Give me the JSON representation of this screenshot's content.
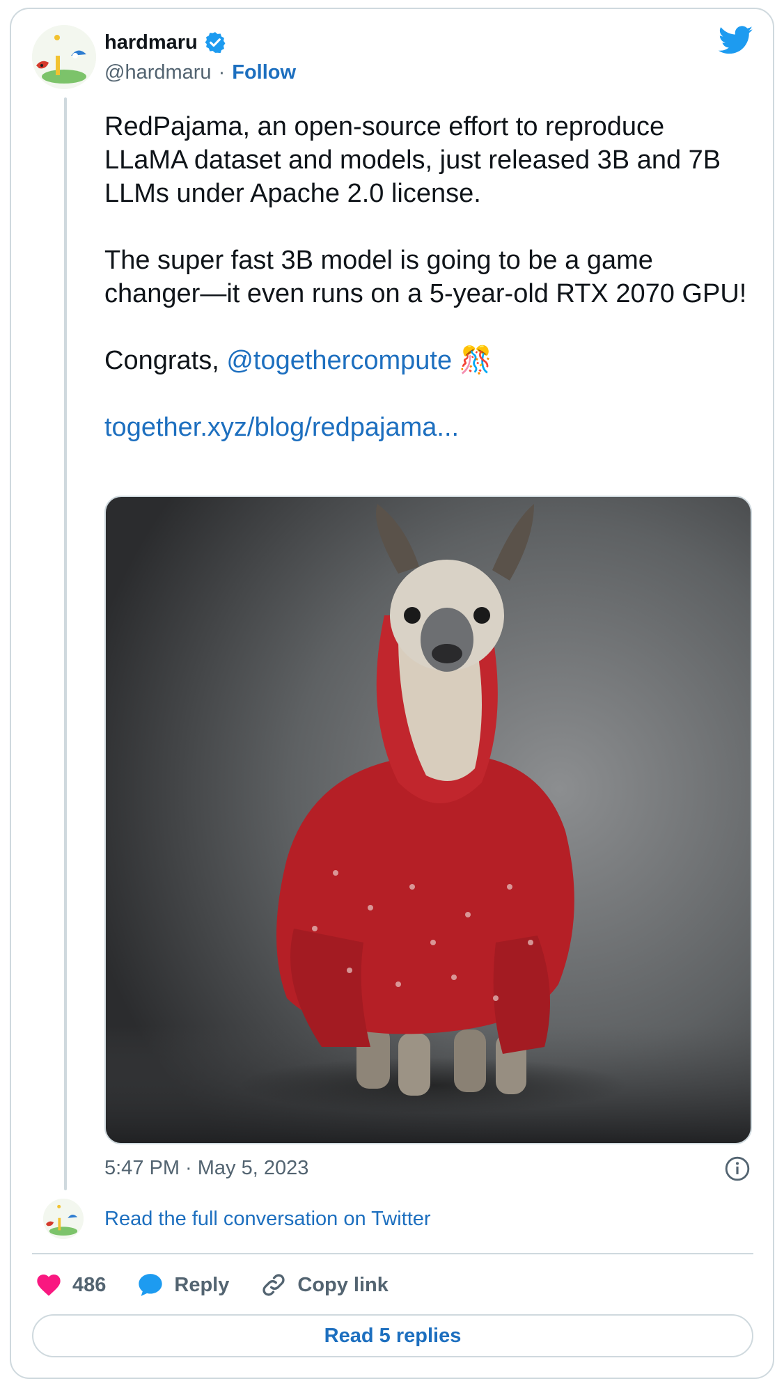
{
  "author": {
    "name": "hardmaru",
    "handle": "@hardmaru",
    "separator": "·",
    "follow_label": "Follow"
  },
  "tweet": {
    "paragraph_1": "RedPajama, an open-source effort to reproduce LLaMA dataset and models, just released 3B and 7B LLMs under Apache 2.0 license.",
    "paragraph_2": "The super fast 3B model is going to be a game changer—it even runs on a 5-year-old RTX 2070 GPU!",
    "congrats_prefix": "Congrats, ",
    "mention": "@togethercompute",
    "emoji": "🎊",
    "link": "together.xyz/blog/redpajama..."
  },
  "timestamp": "5:47 PM · May 5, 2023",
  "read_full_label": "Read the full conversation on Twitter",
  "actions": {
    "like_count": "486",
    "reply_label": "Reply",
    "copy_link_label": "Copy link"
  },
  "read_replies_label": "Read 5 replies",
  "colors": {
    "link": "#1d6fbf",
    "like": "#f91880",
    "reply": "#1d9bf0",
    "verified": "#1d9bf0",
    "twitter_bird": "#1d9bf0",
    "border": "#cfd9de"
  },
  "icons": {
    "verified": "verified-badge-icon",
    "bird": "twitter-bird-icon",
    "info": "info-icon",
    "like": "heart-icon",
    "reply": "speech-bubble-icon",
    "copy": "link-icon"
  }
}
